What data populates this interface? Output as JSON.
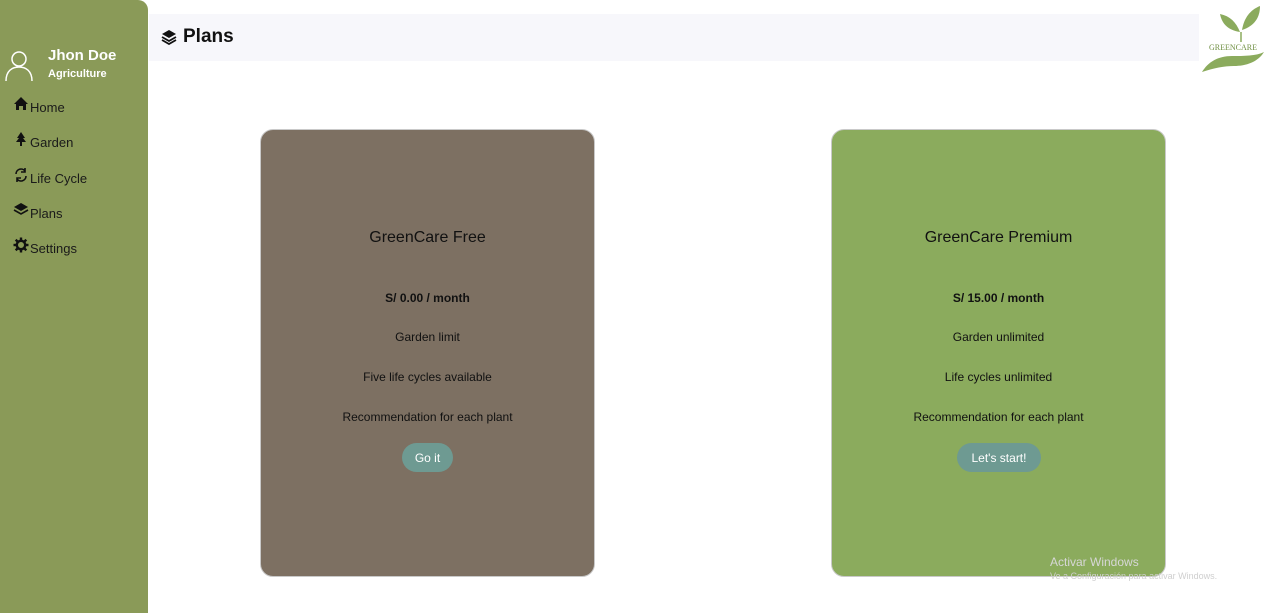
{
  "user": {
    "name": "Jhon Doe",
    "role": "Agriculture"
  },
  "sidebar": {
    "items": [
      {
        "label": "Home",
        "icon": "home-icon"
      },
      {
        "label": "Garden",
        "icon": "tree-icon"
      },
      {
        "label": "Life Cycle",
        "icon": "refresh-icon"
      },
      {
        "label": "Plans",
        "icon": "layers-icon"
      },
      {
        "label": "Settings",
        "icon": "gear-icon"
      }
    ]
  },
  "header": {
    "title": "Plans",
    "title_icon": "layers-icon"
  },
  "logo": {
    "text": "GREENCARE",
    "icon": "leaf-hand-logo"
  },
  "plans": [
    {
      "name": "GreenCare Free",
      "price": "S/ 0.00 / month",
      "features": [
        "Garden limit",
        "Five life cycles available",
        "Recommendation for each plant"
      ],
      "button": "Go it",
      "color": "#7d7062"
    },
    {
      "name": "GreenCare Premium",
      "price": "S/ 15.00 / month",
      "features": [
        "Garden unlimited",
        "Life cycles unlimited",
        "Recommendation for each plant"
      ],
      "button": "Let's start!",
      "color": "#8bab5d"
    }
  ],
  "watermark": {
    "line1": "Activar Windows",
    "line2": "Ve a Configuración para activar Windows."
  },
  "colors": {
    "sidebar": "#8a9a58",
    "button": "#6e9a92",
    "topbar": "#f7f7fb"
  }
}
